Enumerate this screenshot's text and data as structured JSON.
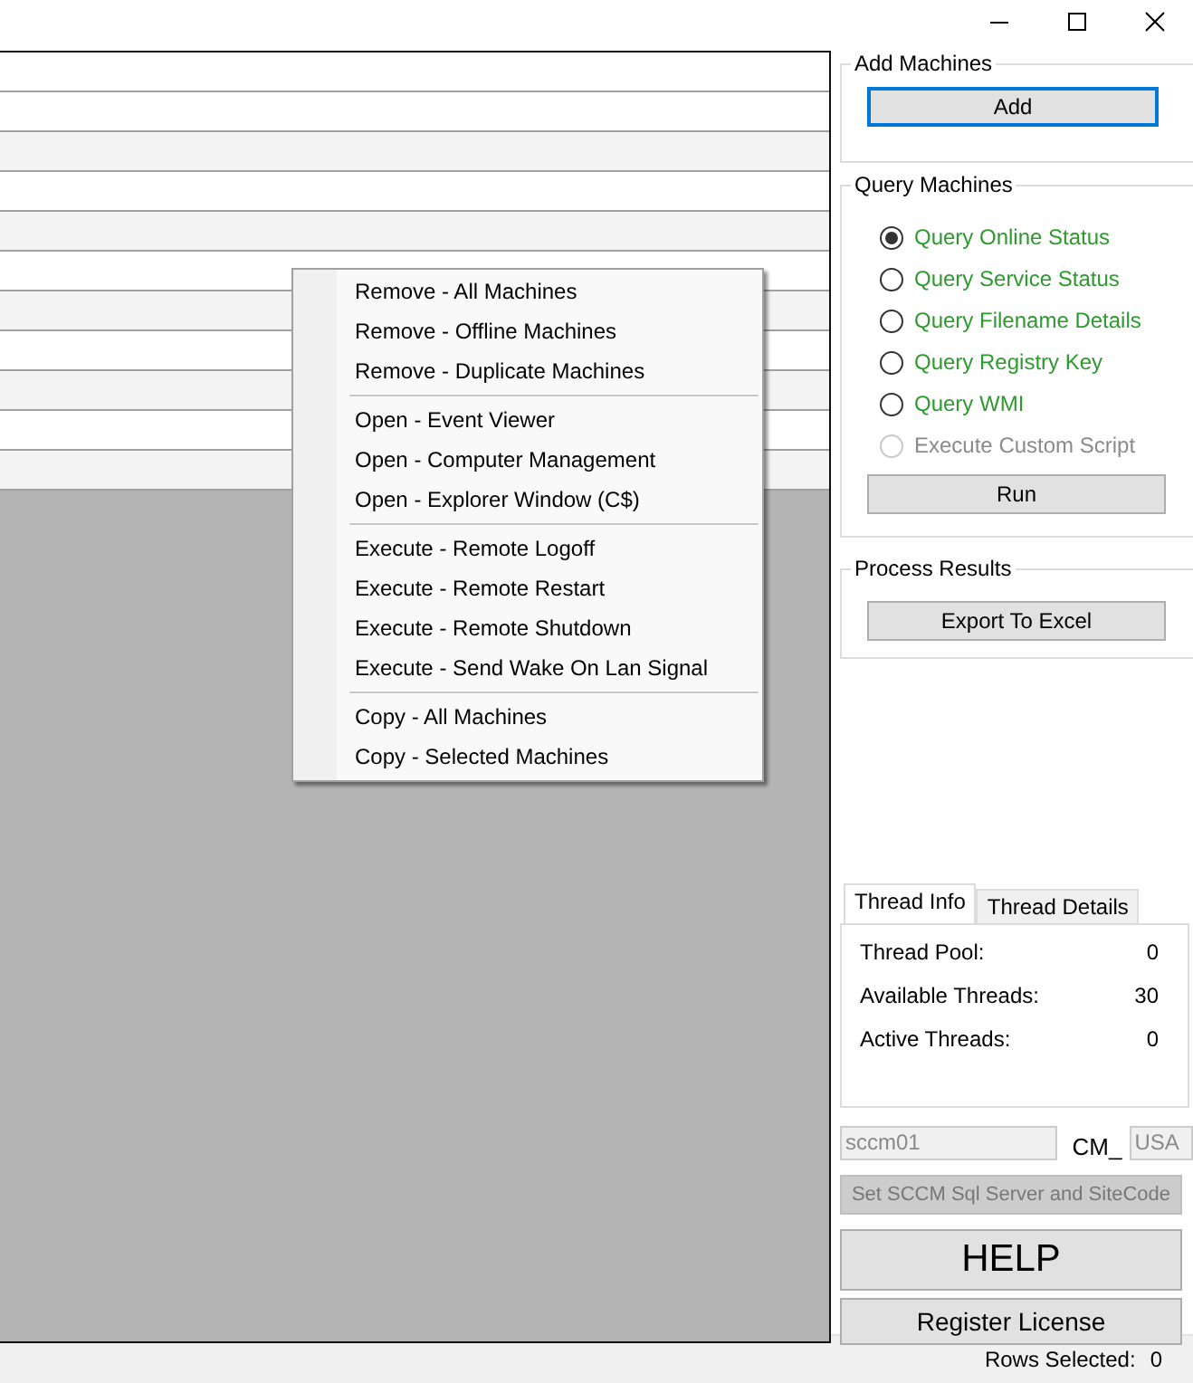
{
  "context_menu": {
    "groups": [
      {
        "items": [
          "Remove - All Machines",
          "Remove - Offline Machines",
          "Remove - Duplicate Machines"
        ]
      },
      {
        "items": [
          "Open - Event Viewer",
          "Open - Computer Management",
          "Open - Explorer Window (C$)"
        ]
      },
      {
        "items": [
          "Execute - Remote Logoff",
          "Execute - Remote Restart",
          "Execute - Remote Shutdown",
          "Execute - Send Wake On Lan Signal"
        ]
      },
      {
        "items": [
          "Copy - All Machines",
          "Copy - Selected Machines"
        ]
      }
    ]
  },
  "add_machines": {
    "title": "Add Machines",
    "button": "Add"
  },
  "query_machines": {
    "title": "Query Machines",
    "options": [
      {
        "label": "Query Online Status",
        "selected": true,
        "disabled": false
      },
      {
        "label": "Query Service Status",
        "selected": false,
        "disabled": false
      },
      {
        "label": "Query Filename Details",
        "selected": false,
        "disabled": false
      },
      {
        "label": "Query Registry Key",
        "selected": false,
        "disabled": false
      },
      {
        "label": "Query WMI",
        "selected": false,
        "disabled": false
      },
      {
        "label": "Execute Custom Script",
        "selected": false,
        "disabled": true
      }
    ],
    "button": "Run"
  },
  "process_results": {
    "title": "Process Results",
    "button": "Export To Excel"
  },
  "thread_tabs": [
    {
      "label": "Thread Info",
      "selected": true
    },
    {
      "label": "Thread Details",
      "selected": false
    }
  ],
  "thread_stats": [
    {
      "label": "Thread Pool:",
      "value": "0"
    },
    {
      "label": "Available Threads:",
      "value": "30"
    },
    {
      "label": "Active Threads:",
      "value": "0"
    }
  ],
  "sccm": {
    "server": "sccm01",
    "prefix": "CM_",
    "site_code": "USA",
    "button": "Set SCCM Sql Server and SiteCode"
  },
  "help_button": "HELP",
  "register_button": "Register License",
  "status_bar": {
    "label": "Rows Selected:",
    "value": "0"
  }
}
